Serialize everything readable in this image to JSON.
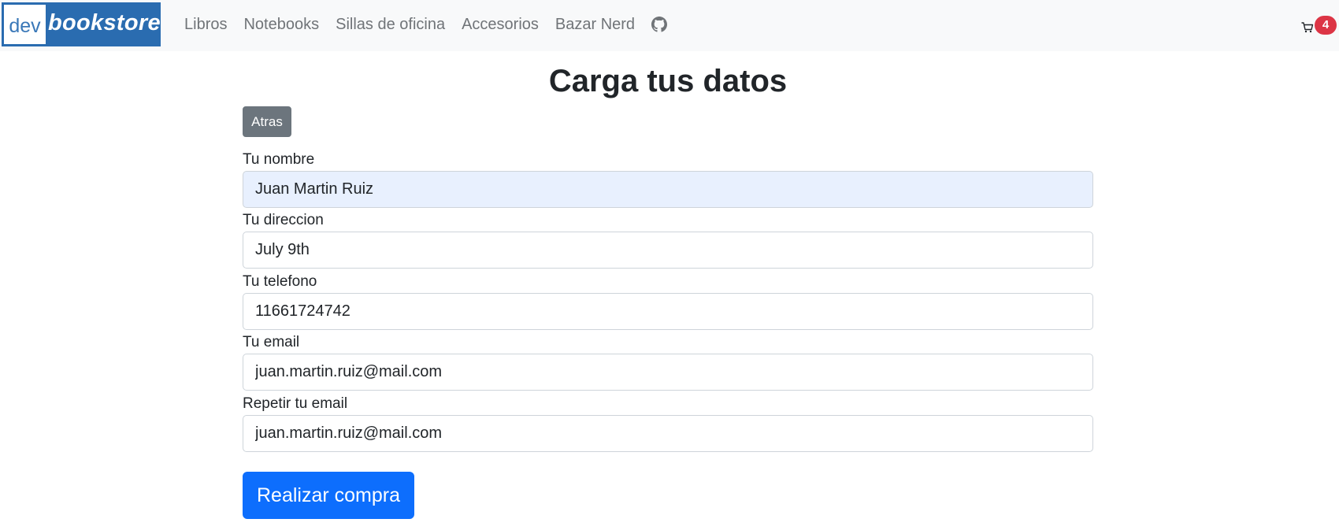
{
  "brand": {
    "prefix": "dev",
    "name": "bookstore"
  },
  "nav": {
    "links": [
      {
        "label": "Libros"
      },
      {
        "label": "Notebooks"
      },
      {
        "label": "Sillas de oficina"
      },
      {
        "label": "Accesorios"
      },
      {
        "label": "Bazar Nerd"
      }
    ],
    "github_icon": "github-icon"
  },
  "cart": {
    "icon": "cart-icon",
    "count": "4"
  },
  "page": {
    "title": "Carga tus datos"
  },
  "back_button": {
    "label": "Atras"
  },
  "form": {
    "fields": [
      {
        "label": "Tu nombre",
        "value": "Juan Martin Ruiz"
      },
      {
        "label": "Tu direccion",
        "value": "July 9th"
      },
      {
        "label": "Tu telefono",
        "value": "11661724742"
      },
      {
        "label": "Tu email",
        "value": "juan.martin.ruiz@mail.com"
      },
      {
        "label": "Repetir tu email",
        "value": "juan.martin.ruiz@mail.com"
      }
    ],
    "submit_label": "Realizar compra"
  },
  "colors": {
    "navbar_bg": "#f8f9fa",
    "logo_bg": "#2a6cb0",
    "badge": "#dc3545",
    "back_button": "#6c757d",
    "primary": "#0d6efd",
    "autofill_bg": "#e8f0fe"
  }
}
